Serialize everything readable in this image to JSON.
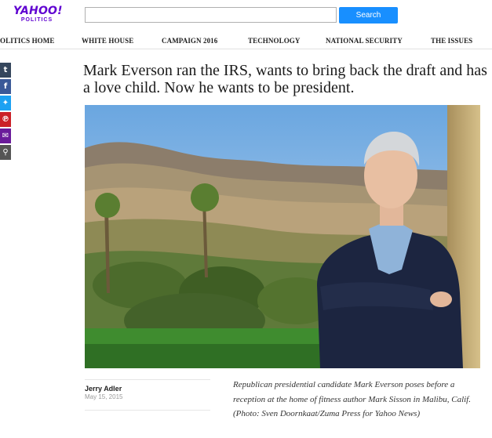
{
  "header": {
    "logo_main": "YAHOO!",
    "logo_sub": "POLITICS",
    "search_placeholder": "",
    "search_button": "Search"
  },
  "nav": {
    "items": [
      {
        "label": "OLITICS HOME"
      },
      {
        "label": "WHITE HOUSE"
      },
      {
        "label": "CAMPAIGN 2016"
      },
      {
        "label": "TECHNOLOGY"
      },
      {
        "label": "NATIONAL SECURITY"
      },
      {
        "label": "THE ISSUES"
      }
    ]
  },
  "share": {
    "buttons": [
      {
        "glyph": "t",
        "icon": "tumblr-icon",
        "color": "#35465c"
      },
      {
        "glyph": "f",
        "icon": "facebook-icon",
        "color": "#3b5998"
      },
      {
        "glyph": "✦",
        "icon": "twitter-icon",
        "color": "#1da1f2"
      },
      {
        "glyph": "℗",
        "icon": "pinterest-icon",
        "color": "#cb2027"
      },
      {
        "glyph": "✉",
        "icon": "mail-icon",
        "color": "#6a1b9a"
      },
      {
        "glyph": "⚲",
        "icon": "link-icon",
        "color": "#555555"
      }
    ]
  },
  "article": {
    "headline": "Mark Everson ran the IRS, wants to bring back the draft and has a love child. Now he wants to be president.",
    "author": "Jerry Adler",
    "date": "May 15, 2015",
    "caption": "Republican presidential candidate Mark Everson poses before a reception at the home of fitness author Mark Sisson in Malibu, Calif. (Photo: Sven Doornkaat/Zuma Press for Yahoo News)"
  },
  "colors": {
    "brand": "#5f01d1",
    "search_button": "#188fff"
  }
}
